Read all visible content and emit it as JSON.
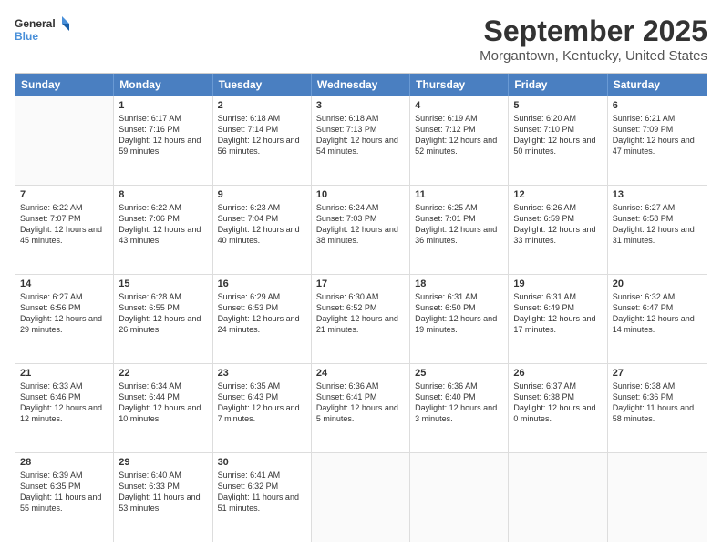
{
  "logo": {
    "general": "General",
    "blue": "Blue"
  },
  "title": {
    "month": "September 2025",
    "location": "Morgantown, Kentucky, United States"
  },
  "header_days": [
    "Sunday",
    "Monday",
    "Tuesday",
    "Wednesday",
    "Thursday",
    "Friday",
    "Saturday"
  ],
  "weeks": [
    [
      {
        "day": "",
        "sunrise": "",
        "sunset": "",
        "daylight": ""
      },
      {
        "day": "1",
        "sunrise": "Sunrise: 6:17 AM",
        "sunset": "Sunset: 7:16 PM",
        "daylight": "Daylight: 12 hours and 59 minutes."
      },
      {
        "day": "2",
        "sunrise": "Sunrise: 6:18 AM",
        "sunset": "Sunset: 7:14 PM",
        "daylight": "Daylight: 12 hours and 56 minutes."
      },
      {
        "day": "3",
        "sunrise": "Sunrise: 6:18 AM",
        "sunset": "Sunset: 7:13 PM",
        "daylight": "Daylight: 12 hours and 54 minutes."
      },
      {
        "day": "4",
        "sunrise": "Sunrise: 6:19 AM",
        "sunset": "Sunset: 7:12 PM",
        "daylight": "Daylight: 12 hours and 52 minutes."
      },
      {
        "day": "5",
        "sunrise": "Sunrise: 6:20 AM",
        "sunset": "Sunset: 7:10 PM",
        "daylight": "Daylight: 12 hours and 50 minutes."
      },
      {
        "day": "6",
        "sunrise": "Sunrise: 6:21 AM",
        "sunset": "Sunset: 7:09 PM",
        "daylight": "Daylight: 12 hours and 47 minutes."
      }
    ],
    [
      {
        "day": "7",
        "sunrise": "Sunrise: 6:22 AM",
        "sunset": "Sunset: 7:07 PM",
        "daylight": "Daylight: 12 hours and 45 minutes."
      },
      {
        "day": "8",
        "sunrise": "Sunrise: 6:22 AM",
        "sunset": "Sunset: 7:06 PM",
        "daylight": "Daylight: 12 hours and 43 minutes."
      },
      {
        "day": "9",
        "sunrise": "Sunrise: 6:23 AM",
        "sunset": "Sunset: 7:04 PM",
        "daylight": "Daylight: 12 hours and 40 minutes."
      },
      {
        "day": "10",
        "sunrise": "Sunrise: 6:24 AM",
        "sunset": "Sunset: 7:03 PM",
        "daylight": "Daylight: 12 hours and 38 minutes."
      },
      {
        "day": "11",
        "sunrise": "Sunrise: 6:25 AM",
        "sunset": "Sunset: 7:01 PM",
        "daylight": "Daylight: 12 hours and 36 minutes."
      },
      {
        "day": "12",
        "sunrise": "Sunrise: 6:26 AM",
        "sunset": "Sunset: 6:59 PM",
        "daylight": "Daylight: 12 hours and 33 minutes."
      },
      {
        "day": "13",
        "sunrise": "Sunrise: 6:27 AM",
        "sunset": "Sunset: 6:58 PM",
        "daylight": "Daylight: 12 hours and 31 minutes."
      }
    ],
    [
      {
        "day": "14",
        "sunrise": "Sunrise: 6:27 AM",
        "sunset": "Sunset: 6:56 PM",
        "daylight": "Daylight: 12 hours and 29 minutes."
      },
      {
        "day": "15",
        "sunrise": "Sunrise: 6:28 AM",
        "sunset": "Sunset: 6:55 PM",
        "daylight": "Daylight: 12 hours and 26 minutes."
      },
      {
        "day": "16",
        "sunrise": "Sunrise: 6:29 AM",
        "sunset": "Sunset: 6:53 PM",
        "daylight": "Daylight: 12 hours and 24 minutes."
      },
      {
        "day": "17",
        "sunrise": "Sunrise: 6:30 AM",
        "sunset": "Sunset: 6:52 PM",
        "daylight": "Daylight: 12 hours and 21 minutes."
      },
      {
        "day": "18",
        "sunrise": "Sunrise: 6:31 AM",
        "sunset": "Sunset: 6:50 PM",
        "daylight": "Daylight: 12 hours and 19 minutes."
      },
      {
        "day": "19",
        "sunrise": "Sunrise: 6:31 AM",
        "sunset": "Sunset: 6:49 PM",
        "daylight": "Daylight: 12 hours and 17 minutes."
      },
      {
        "day": "20",
        "sunrise": "Sunrise: 6:32 AM",
        "sunset": "Sunset: 6:47 PM",
        "daylight": "Daylight: 12 hours and 14 minutes."
      }
    ],
    [
      {
        "day": "21",
        "sunrise": "Sunrise: 6:33 AM",
        "sunset": "Sunset: 6:46 PM",
        "daylight": "Daylight: 12 hours and 12 minutes."
      },
      {
        "day": "22",
        "sunrise": "Sunrise: 6:34 AM",
        "sunset": "Sunset: 6:44 PM",
        "daylight": "Daylight: 12 hours and 10 minutes."
      },
      {
        "day": "23",
        "sunrise": "Sunrise: 6:35 AM",
        "sunset": "Sunset: 6:43 PM",
        "daylight": "Daylight: 12 hours and 7 minutes."
      },
      {
        "day": "24",
        "sunrise": "Sunrise: 6:36 AM",
        "sunset": "Sunset: 6:41 PM",
        "daylight": "Daylight: 12 hours and 5 minutes."
      },
      {
        "day": "25",
        "sunrise": "Sunrise: 6:36 AM",
        "sunset": "Sunset: 6:40 PM",
        "daylight": "Daylight: 12 hours and 3 minutes."
      },
      {
        "day": "26",
        "sunrise": "Sunrise: 6:37 AM",
        "sunset": "Sunset: 6:38 PM",
        "daylight": "Daylight: 12 hours and 0 minutes."
      },
      {
        "day": "27",
        "sunrise": "Sunrise: 6:38 AM",
        "sunset": "Sunset: 6:36 PM",
        "daylight": "Daylight: 11 hours and 58 minutes."
      }
    ],
    [
      {
        "day": "28",
        "sunrise": "Sunrise: 6:39 AM",
        "sunset": "Sunset: 6:35 PM",
        "daylight": "Daylight: 11 hours and 55 minutes."
      },
      {
        "day": "29",
        "sunrise": "Sunrise: 6:40 AM",
        "sunset": "Sunset: 6:33 PM",
        "daylight": "Daylight: 11 hours and 53 minutes."
      },
      {
        "day": "30",
        "sunrise": "Sunrise: 6:41 AM",
        "sunset": "Sunset: 6:32 PM",
        "daylight": "Daylight: 11 hours and 51 minutes."
      },
      {
        "day": "",
        "sunrise": "",
        "sunset": "",
        "daylight": ""
      },
      {
        "day": "",
        "sunrise": "",
        "sunset": "",
        "daylight": ""
      },
      {
        "day": "",
        "sunrise": "",
        "sunset": "",
        "daylight": ""
      },
      {
        "day": "",
        "sunrise": "",
        "sunset": "",
        "daylight": ""
      }
    ]
  ]
}
